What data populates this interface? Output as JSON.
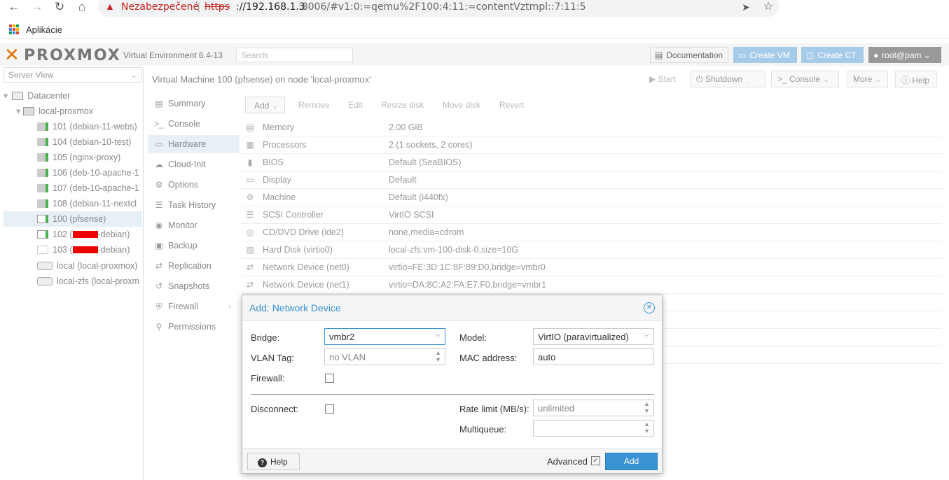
{
  "browser": {
    "insecure_label": "Nezabezpečené",
    "url_proto": "https",
    "url_host": "://192.168.1.3",
    "url_rest": ":8006/#v1:0:=qemu%2F100:4:11:=contentVztmpl::7:11:5",
    "bookmark_apps": "Aplikácie"
  },
  "header": {
    "logo": "PROXMOX",
    "version": "Virtual Environment 6.4-13",
    "search_placeholder": "Search",
    "documentation": "Documentation",
    "create_vm": "Create VM",
    "create_ct": "Create CT",
    "user": "root@pam"
  },
  "tree": {
    "view": "Server View",
    "items": [
      {
        "label": "Datacenter"
      },
      {
        "label": "local-proxmox"
      },
      {
        "label": "101 (debian-11-webs)"
      },
      {
        "label": "104 (debian-10-test)"
      },
      {
        "label": "105 (nginx-proxy)"
      },
      {
        "label": "106 (deb-10-apache-1"
      },
      {
        "label": "107 (deb-10-apache-1"
      },
      {
        "label": "108 (debian-11-nextcl"
      },
      {
        "label": "100 (pfsense)"
      },
      {
        "label_pre": "102 (",
        "label_post": "-debian)"
      },
      {
        "label_pre": "103 (",
        "label_post": "-debian)"
      },
      {
        "label": "local (local-proxmox)"
      },
      {
        "label": "local-zfs (local-proxm"
      }
    ]
  },
  "vm": {
    "title": "Virtual Machine 100 (pfsense) on node 'local-proxmox'",
    "start": "Start",
    "shutdown": "Shutdown",
    "console": "Console",
    "more": "More",
    "help": "Help"
  },
  "nav": [
    {
      "label": "Summary",
      "icon": "summary-icon"
    },
    {
      "label": "Console",
      "icon": "console-icon"
    },
    {
      "label": "Hardware",
      "icon": "monitor-icon"
    },
    {
      "label": "Cloud-Init",
      "icon": "cloud-icon"
    },
    {
      "label": "Options",
      "icon": "gear-icon"
    },
    {
      "label": "Task History",
      "icon": "list-icon"
    },
    {
      "label": "Monitor",
      "icon": "eye-icon"
    },
    {
      "label": "Backup",
      "icon": "floppy-icon"
    },
    {
      "label": "Replication",
      "icon": "retweet-icon"
    },
    {
      "label": "Snapshots",
      "icon": "history-icon"
    },
    {
      "label": "Firewall",
      "icon": "shield-icon"
    },
    {
      "label": "Permissions",
      "icon": "unlock-icon"
    }
  ],
  "hw_toolbar": {
    "add": "Add",
    "remove": "Remove",
    "edit": "Edit",
    "resize": "Resize disk",
    "move": "Move disk",
    "revert": "Revert"
  },
  "hardware": [
    {
      "key": "Memory",
      "value": "2.00 GiB"
    },
    {
      "key": "Processors",
      "value": "2 (1 sockets, 2 cores)"
    },
    {
      "key": "BIOS",
      "value": "Default (SeaBIOS)"
    },
    {
      "key": "Display",
      "value": "Default"
    },
    {
      "key": "Machine",
      "value": "Default (i440fx)"
    },
    {
      "key": "SCSI Controller",
      "value": "VirtIO SCSI"
    },
    {
      "key": "CD/DVD Drive (ide2)",
      "value": "none,media=cdrom"
    },
    {
      "key": "Hard Disk (virtio0)",
      "value": "local-zfs:vm-100-disk-0,size=10G"
    },
    {
      "key": "Network Device (net0)",
      "value": "virtio=FE:3D:1C:8F:89:D0,bridge=vmbr0"
    },
    {
      "key": "Network Device (net1)",
      "value": "virtio=DA:8C:A2:FA:E7:F0,bridge=vmbr1"
    }
  ],
  "dialog": {
    "title": "Add: Network Device",
    "bridge_label": "Bridge:",
    "bridge_value": "vmbr2",
    "vlan_label": "VLAN Tag:",
    "vlan_placeholder": "no VLAN",
    "firewall_label": "Firewall:",
    "model_label": "Model:",
    "model_value": "VirtIO (paravirtualized)",
    "mac_label": "MAC address:",
    "mac_value": "auto",
    "disconnect_label": "Disconnect:",
    "rate_label": "Rate limit (MB/s):",
    "rate_placeholder": "unlimited",
    "multiqueue_label": "Multiqueue:",
    "help": "Help",
    "advanced": "Advanced",
    "add": "Add"
  }
}
